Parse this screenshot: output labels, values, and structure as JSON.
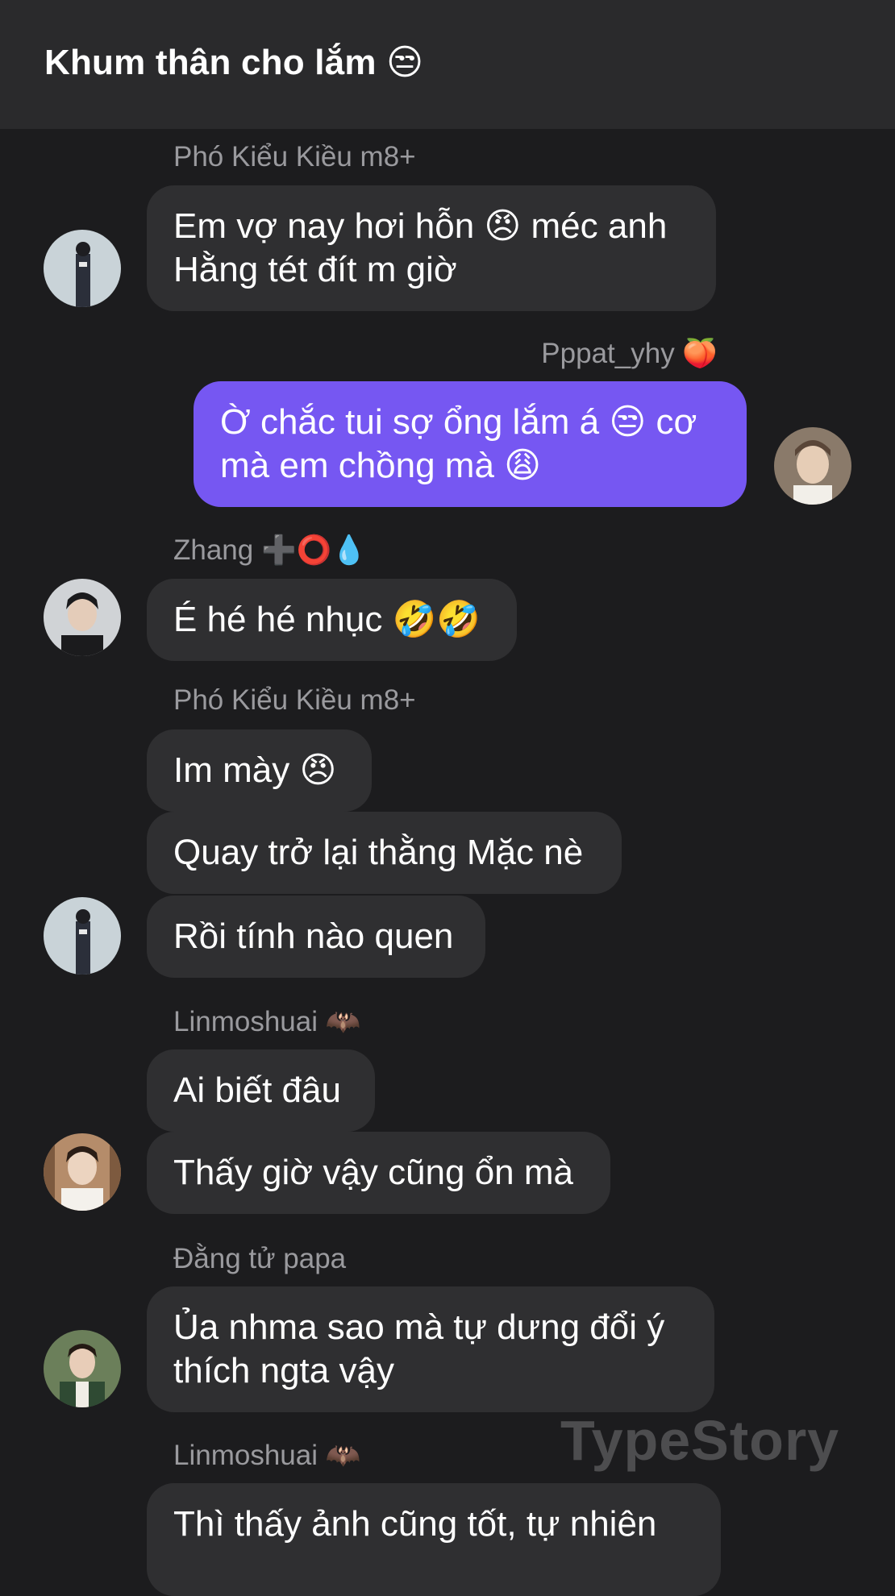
{
  "header": {
    "title": "Khum thân cho lắm 😒"
  },
  "messages": [
    {
      "sender": "Phó Kiểu Kiều m8+",
      "bubbles": [
        "Em vợ nay hơi hỗn 😠 méc anh\nHằng tét đít m giờ"
      ],
      "avatar": "avatar-pho-kieu-kieu"
    },
    {
      "sender": "Pppat_yhy 🍑",
      "bubbles": [
        "Ờ chắc tui sợ ổng lắm á 😒 cơ\nmà em chồng mà 😩"
      ],
      "avatar": "avatar-pppat-yhy",
      "mine": true
    },
    {
      "sender": "Zhang ➕⭕💧",
      "bubbles": [
        "É hé hé nhục 🤣🤣"
      ],
      "avatar": "avatar-zhang"
    },
    {
      "sender": "Phó Kiểu Kiều m8+",
      "bubbles": [
        "Im mày 😠",
        "Quay trở lại thằng Mặc nè",
        "Rồi tính nào quen"
      ],
      "avatar": "avatar-pho-kieu-kieu"
    },
    {
      "sender": "Linmoshuai 🦇",
      "bubbles": [
        "Ai biết đâu",
        "Thấy giờ vậy cũng ổn mà"
      ],
      "avatar": "avatar-linmoshuai"
    },
    {
      "sender": "Đằng tử papa",
      "bubbles": [
        "Ủa nhma sao mà tự dưng đổi ý\nthích ngta vậy"
      ],
      "avatar": "avatar-dang-tu-papa"
    },
    {
      "sender": "Linmoshuai 🦇",
      "bubbles": [
        "Thì thấy ảnh cũng tốt, tự nhiên"
      ],
      "avatar": "avatar-linmoshuai"
    }
  ],
  "watermark": "TypeStory",
  "colors": {
    "background": "#1c1c1e",
    "header": "#2a2a2c",
    "bubble_other": "#2f2f31",
    "bubble_mine": "#7657f2",
    "sender_text": "#9a9a9e"
  }
}
